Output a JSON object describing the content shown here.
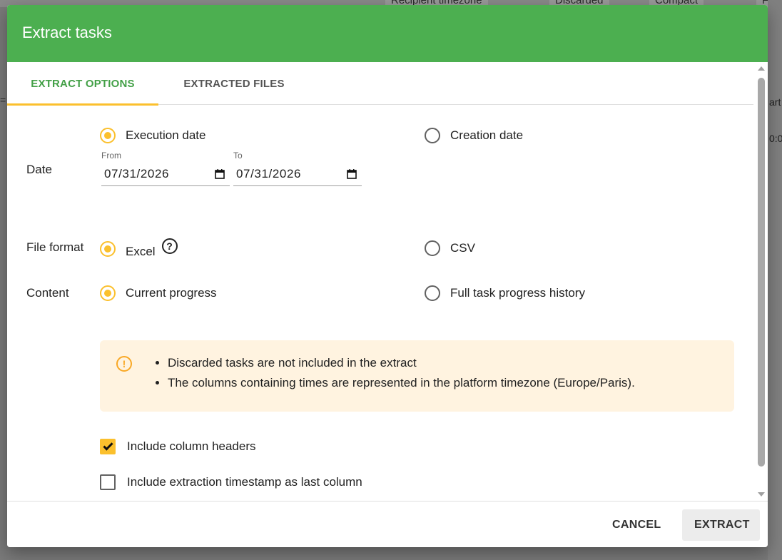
{
  "background": {
    "chips": [
      "Recipient timezone",
      "Discarded",
      "Compact",
      "F"
    ],
    "right_fragments": [
      "art",
      "0:0"
    ],
    "left_glyph": "="
  },
  "dialog": {
    "title": "Extract tasks",
    "tabs": [
      {
        "label": "EXTRACT OPTIONS",
        "active": true
      },
      {
        "label": "EXTRACTED FILES",
        "active": false
      }
    ],
    "date": {
      "label": "Date",
      "options": [
        {
          "label": "Execution date",
          "selected": true
        },
        {
          "label": "Creation date",
          "selected": false
        }
      ],
      "from": {
        "caption": "From",
        "value": "07/31/2026"
      },
      "to": {
        "caption": "To",
        "value": "07/31/2026"
      }
    },
    "file_format": {
      "label": "File format",
      "options": [
        {
          "label": "Excel",
          "selected": true,
          "help": "?"
        },
        {
          "label": "CSV",
          "selected": false
        }
      ]
    },
    "content": {
      "label": "Content",
      "options": [
        {
          "label": "Current progress",
          "selected": true
        },
        {
          "label": "Full task progress history",
          "selected": false
        }
      ]
    },
    "notice": {
      "icon": "!",
      "items": [
        "Discarded tasks are not included in the extract",
        "The columns containing times are represented in the platform timezone (Europe/Paris)."
      ]
    },
    "checkboxes": [
      {
        "label": "Include column headers",
        "checked": true
      },
      {
        "label": "Include extraction timestamp as last column",
        "checked": false
      }
    ],
    "buttons": {
      "cancel": "CANCEL",
      "extract": "EXTRACT"
    }
  },
  "colors": {
    "header": "#4caf50",
    "accent": "#fbc02d",
    "active_tab": "#43a047",
    "notice_bg": "#fff3e0"
  }
}
